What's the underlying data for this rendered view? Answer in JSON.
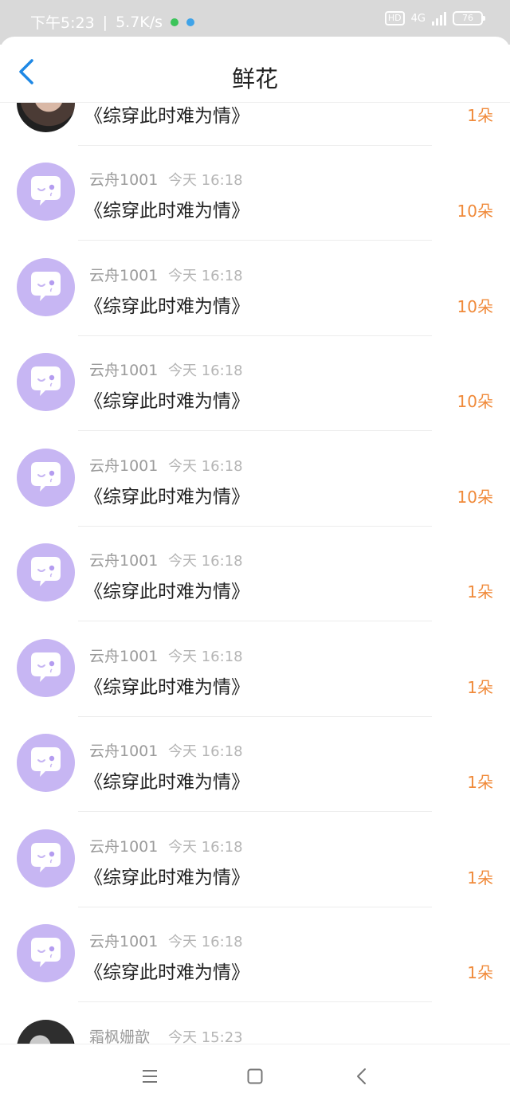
{
  "status_bar": {
    "time": "下午5:23",
    "separator": "|",
    "speed": "5.7K/s",
    "hd": "HD",
    "network": "4G",
    "battery": "76",
    "dot_colors": [
      "#3cc45a",
      "#3fa3e8"
    ]
  },
  "header": {
    "title": "鲜花",
    "back_icon": "chevron-left-icon",
    "accent": "#1e88e5"
  },
  "partial_top_row": {
    "book": "《综穿此时难为情》",
    "count": "1朵"
  },
  "rows": [
    {
      "user": "云舟1001",
      "time": "今天 16:18",
      "book": "《综穿此时难为情》",
      "count": "10朵"
    },
    {
      "user": "云舟1001",
      "time": "今天 16:18",
      "book": "《综穿此时难为情》",
      "count": "10朵"
    },
    {
      "user": "云舟1001",
      "time": "今天 16:18",
      "book": "《综穿此时难为情》",
      "count": "10朵"
    },
    {
      "user": "云舟1001",
      "time": "今天 16:18",
      "book": "《综穿此时难为情》",
      "count": "10朵"
    },
    {
      "user": "云舟1001",
      "time": "今天 16:18",
      "book": "《综穿此时难为情》",
      "count": "1朵"
    },
    {
      "user": "云舟1001",
      "time": "今天 16:18",
      "book": "《综穿此时难为情》",
      "count": "1朵"
    },
    {
      "user": "云舟1001",
      "time": "今天 16:18",
      "book": "《综穿此时难为情》",
      "count": "1朵"
    },
    {
      "user": "云舟1001",
      "time": "今天 16:18",
      "book": "《综穿此时难为情》",
      "count": "1朵"
    },
    {
      "user": "云舟1001",
      "time": "今天 16:18",
      "book": "《综穿此时难为情》",
      "count": "1朵"
    }
  ],
  "partial_bottom_row": {
    "user": "霜枫姗歆",
    "time": "今天 15:23"
  },
  "nav_bar": {
    "icons": [
      "menu-icon",
      "home-square-icon",
      "back-triangle-icon"
    ]
  },
  "colors": {
    "count": "#f08a3a",
    "avatar_default": "#c7b6f3"
  }
}
